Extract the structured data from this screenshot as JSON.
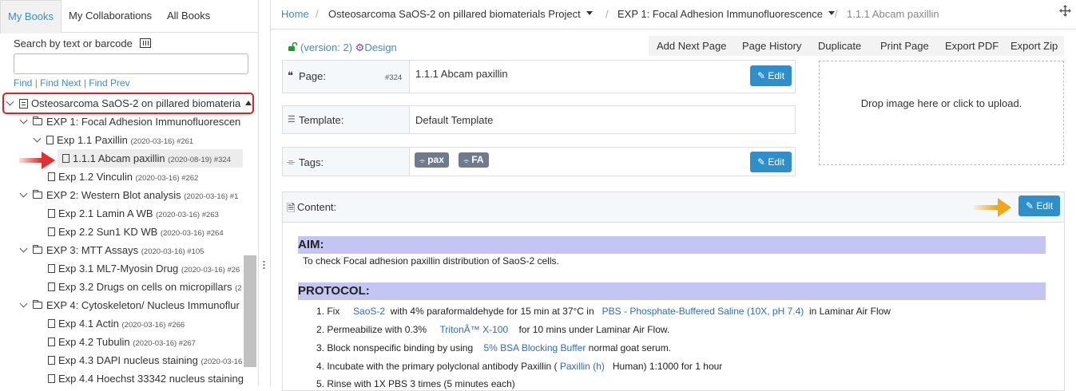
{
  "sidebar": {
    "tabs": [
      "My Books",
      "My Collaborations",
      "All Books"
    ],
    "search_label": "Search by text or barcode",
    "search_value": "",
    "find": {
      "find": "Find",
      "next": "Find Next",
      "prev": "Find Prev"
    },
    "tree": [
      {
        "label": "Osteosarcoma SaOS-2 on pillared biomateria",
        "meta": ""
      },
      {
        "label": "EXP 1: Focal Adhesion Immunofluorescen",
        "meta": ""
      },
      {
        "label": "Exp 1.1 Paxillin",
        "meta": "(2020-03-16) #261"
      },
      {
        "label": "1.1.1 Abcam paxillin",
        "meta": "(2020-08-19) #324"
      },
      {
        "label": "Exp 1.2 Vinculin",
        "meta": "(2020-03-16) #262"
      },
      {
        "label": "EXP 2: Western Blot analysis",
        "meta": "(2020-03-16) #1"
      },
      {
        "label": "Exp 2.1 Lamin A WB",
        "meta": "(2020-03-16) #263"
      },
      {
        "label": "Exp 2.2 Sun1 KD WB",
        "meta": "(2020-03-16) #264"
      },
      {
        "label": "EXP 3: MTT Assays",
        "meta": "(2020-03-16) #105"
      },
      {
        "label": "Exp 3.1 ML7-Myosin Drug",
        "meta": "(2020-03-16) #26"
      },
      {
        "label": "Exp 3.2 Drugs on cells on micropillars",
        "meta": "(2"
      },
      {
        "label": "EXP 4: Cytoskeleton/ Nucleus Immunoflur",
        "meta": ""
      },
      {
        "label": "Exp 4.1 Actin",
        "meta": "(2020-03-16) #266"
      },
      {
        "label": "Exp 4.2 Tubulin",
        "meta": "(2020-03-16) #267"
      },
      {
        "label": "Exp 4.3 DAPI nucleus staining",
        "meta": "(2020-03-16"
      },
      {
        "label": "Exp 4.4 Hoechst 33342 nucleus staining",
        "meta": ""
      }
    ]
  },
  "breadcrumb": {
    "home": "Home",
    "project": "Osteosarcoma SaOS-2 on pillared biomaterials Project",
    "exp": "EXP 1: Focal Adhesion Immunofluorescence",
    "page": "1.1.1 Abcam paxillin"
  },
  "header": {
    "version": "(version: 2)",
    "design": "Design",
    "actions": [
      "Add Next Page",
      "Page History",
      "Duplicate",
      "Print Page",
      "Export PDF",
      "Export Zip"
    ]
  },
  "fields": {
    "page_label": "Page:",
    "page_num": "#324",
    "page_value": "1.1.1 Abcam paxillin",
    "template_label": "Template:",
    "template_value": "Default Template",
    "tags_label": "Tags:",
    "tags": [
      "pax",
      "FA"
    ],
    "edit": "Edit"
  },
  "dropzone": "Drop image here or click to upload.",
  "content": {
    "label": "Content:",
    "edit": "Edit",
    "aim_heading": "AIM:",
    "aim_text": "To check Focal adhesion paxillin distribution of SaoS-2 cells.",
    "protocol_heading": "PROTOCOL:",
    "steps": {
      "s1a": "1. Fix",
      "s1b": "SaoS-2",
      "s1c": "with 4% paraformaldehyde for 15 min at 37°C in",
      "s1d": "PBS - Phosphate-Buffered Saline (10X, pH 7.4)",
      "s1e": "in Laminar Air Flow",
      "s2a": "2. Permeabilize with 0.3%",
      "s2b": "TritonÂ™ X-100",
      "s2c": "for 10 mins under Laminar Air Flow.",
      "s3a": "3. Block nonspecific binding by using",
      "s3b": "5% BSA Blocking Buffer",
      "s3c": "normal goat serum.",
      "s4a": "4. Incubate with the primary polyclonal antibody Paxillin (",
      "s4b": "Paxillin (h)",
      "s4c": "Human) 1:1000 for 1 hour",
      "s5a": "5. Rinse with 1X PBS 3 times (5 minutes each)"
    }
  },
  "colors": {
    "accent": "#3a8ec9",
    "edit_button": "#2e8fcb",
    "section_band": "#c5c5f3",
    "highlight_box": "#e02020"
  }
}
